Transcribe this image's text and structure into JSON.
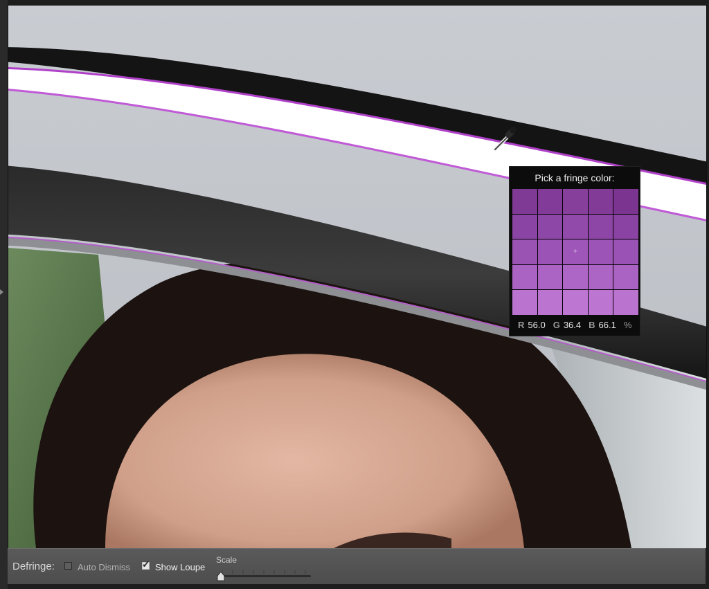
{
  "app": {
    "accent_fringe_color": "#8e3aa6"
  },
  "loupe": {
    "title": "Pick a fringe color:",
    "readout": {
      "r_label": "R",
      "r_value": "56.0",
      "g_label": "G",
      "g_value": "36.4",
      "b_label": "B",
      "b_value": "66.1",
      "unit": "%"
    },
    "swatches": [
      [
        "#7e3a94",
        "#833b99",
        "#86409c",
        "#833b98",
        "#7b3591"
      ],
      [
        "#8a44a3",
        "#8d47a6",
        "#9149aa",
        "#8e46a6",
        "#8a43a2"
      ],
      [
        "#9a52b3",
        "#9b53b5",
        "#9e56b8",
        "#9c55b6",
        "#9a53b4"
      ],
      [
        "#ab63c3",
        "#ac64c4",
        "#ae66c6",
        "#ad65c5",
        "#ab63c3"
      ],
      [
        "#ba74d0",
        "#bb75d1",
        "#bd77d3",
        "#bc76d2",
        "#ba74d0"
      ]
    ],
    "center_marker": "+"
  },
  "cursor": {
    "icon": "eyedropper-icon"
  },
  "toolbar": {
    "defringe_label": "Defringe:",
    "auto_dismiss_label": "Auto Dismiss",
    "auto_dismiss_checked": false,
    "show_loupe_label": "Show Loupe",
    "show_loupe_checked": true,
    "checkmark_glyph": "✓",
    "scale_label": "Scale",
    "scale_value": 0.0
  }
}
